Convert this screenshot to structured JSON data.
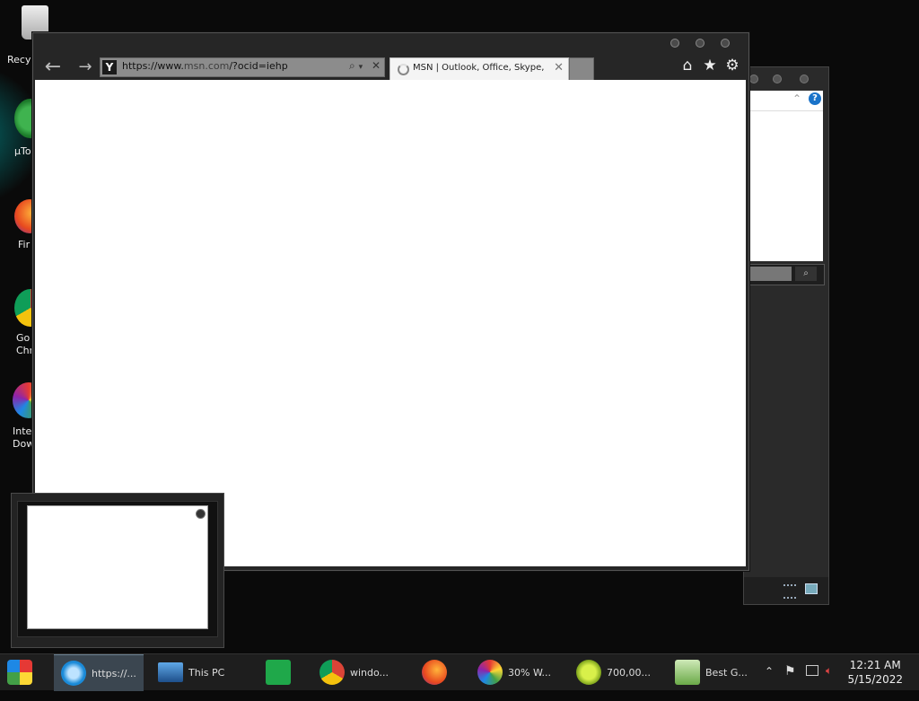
{
  "desktop": {
    "icons": [
      {
        "label": "Recyc",
        "icon": "recycle-bin-icon"
      },
      {
        "label": "µTo",
        "icon": "utorrent-icon"
      },
      {
        "label": "Fir",
        "icon": "firefox-icon"
      },
      {
        "label": "Go\nChr",
        "icon": "chrome-icon"
      },
      {
        "label": "Inte\nDow",
        "icon": "idm-icon"
      }
    ]
  },
  "browser": {
    "address_prefix": "https://www.",
    "address_domain": "msn.com",
    "address_suffix": "/?ocid=iehp",
    "tab_title": "MSN | Outlook, Office, Skype, Bi...",
    "favicon": "Y"
  },
  "taskbar": {
    "items": [
      {
        "label": "",
        "icon": "start-orb-icon"
      },
      {
        "label": "https://...",
        "icon": "internet-explorer-icon",
        "active": true
      },
      {
        "label": "This PC",
        "icon": "computer-icon"
      },
      {
        "label": "",
        "icon": "store-icon"
      },
      {
        "label": "windo...",
        "icon": "chrome-icon"
      },
      {
        "label": "",
        "icon": "firefox-icon"
      },
      {
        "label": "30% W...",
        "icon": "idm-icon"
      },
      {
        "label": "700,00...",
        "icon": "app-s-icon"
      },
      {
        "label": "Best G...",
        "icon": "installer-icon"
      }
    ],
    "clock_time": "12:21 AM",
    "clock_date": "5/15/2022"
  }
}
